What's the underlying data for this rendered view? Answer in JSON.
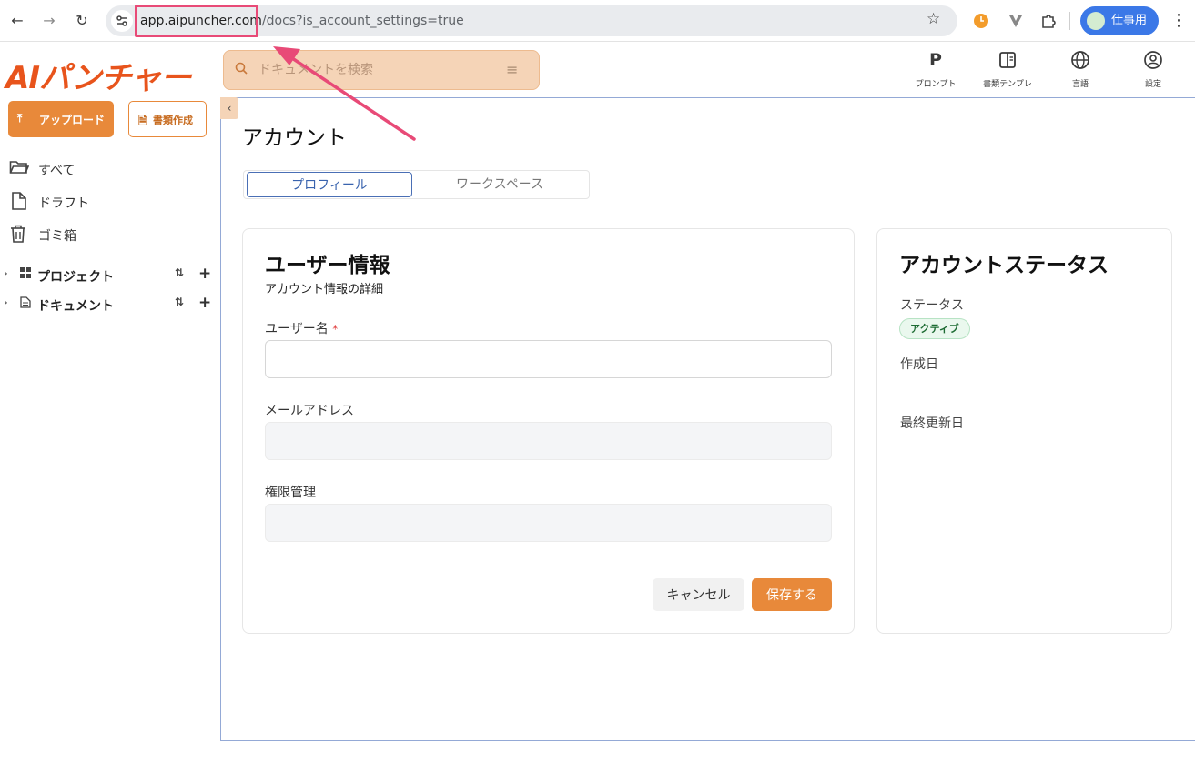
{
  "browser": {
    "url_host": "app.aipuncher.com",
    "url_path": "/docs?is_account_settings=true",
    "profile_label": "仕事用"
  },
  "app": {
    "logo_text": "AIパンチャー",
    "search_placeholder": "ドキュメントを検索"
  },
  "toolbar": {
    "items": [
      {
        "label": "プロンプト",
        "icon": "prompt-icon"
      },
      {
        "label": "書類テンプレ",
        "icon": "template-icon"
      },
      {
        "label": "言語",
        "icon": "globe-icon"
      },
      {
        "label": "設定",
        "icon": "user-circle-icon"
      }
    ]
  },
  "sidebar": {
    "upload_label": "アップロード",
    "create_doc_label": "書類作成",
    "items": [
      {
        "label": "すべて",
        "icon": "folder-icon"
      },
      {
        "label": "ドラフト",
        "icon": "file-icon"
      },
      {
        "label": "ゴミ箱",
        "icon": "trash-icon"
      }
    ],
    "sections": [
      {
        "label": "プロジェクト",
        "icon": "grid-icon"
      },
      {
        "label": "ドキュメント",
        "icon": "document-icon"
      }
    ]
  },
  "page": {
    "title": "アカウント",
    "tabs": [
      {
        "label": "プロフィール",
        "active": true
      },
      {
        "label": "ワークスペース",
        "active": false
      }
    ]
  },
  "user_info": {
    "title": "ユーザー情報",
    "subtitle": "アカウント情報の詳細",
    "username_label": "ユーザー名",
    "required_mark": "*",
    "username_value": "",
    "email_label": "メールアドレス",
    "email_value": "",
    "role_label": "権限管理",
    "role_value": "",
    "cancel_label": "キャンセル",
    "save_label": "保存する"
  },
  "account_status": {
    "title": "アカウントステータス",
    "status_label": "ステータス",
    "status_value": "アクティブ",
    "created_label": "作成日",
    "updated_label": "最終更新日"
  },
  "colors": {
    "accent": "#e8893a",
    "logo": "#e8541c",
    "highlight": "#e84a77",
    "tab_active": "#3963ae"
  }
}
